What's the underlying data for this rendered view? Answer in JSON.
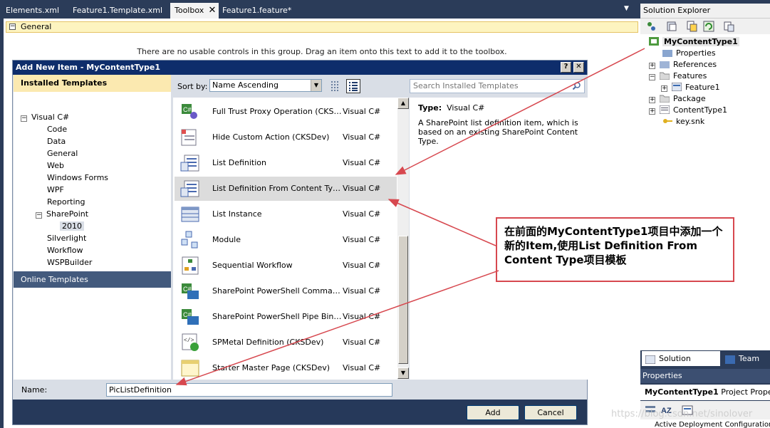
{
  "doc_tabs": [
    {
      "label": "Elements.xml",
      "active": false
    },
    {
      "label": "Feature1.Template.xml",
      "active": false
    },
    {
      "label": "Toolbox",
      "active": true
    },
    {
      "label": "Feature1.feature*",
      "active": false
    }
  ],
  "toolbox": {
    "group_label": "General",
    "empty_message": "There are no usable controls in this group. Drag an item onto this text to add it to the toolbox."
  },
  "dialog": {
    "title": "Add New Item - MyContentType1",
    "help_glyph": "?",
    "close_glyph": "✕",
    "installed_header": "Installed Templates",
    "tree": {
      "root": "Visual C#",
      "children": [
        "Code",
        "Data",
        "General",
        "Web",
        "Windows Forms",
        "WPF",
        "Reporting"
      ],
      "sharepoint": "SharePoint",
      "sharepoint_child": "2010",
      "after": [
        "Silverlight",
        "Workflow",
        "WSPBuilder"
      ]
    },
    "online_templates": "Online Templates",
    "sort_label": "Sort by:",
    "sort_value": "Name Ascending",
    "search_placeholder": "Search Installed Templates",
    "items": [
      {
        "name": "Full Trust Proxy Operation (CKSDev)",
        "lang": "Visual C#",
        "icon": "proxy-icon"
      },
      {
        "name": "Hide Custom Action (CKSDev)",
        "lang": "Visual C#",
        "icon": "custom-action-icon"
      },
      {
        "name": "List Definition",
        "lang": "Visual C#",
        "icon": "list-definition-icon"
      },
      {
        "name": "List Definition From Content Type",
        "lang": "Visual C#",
        "icon": "list-definition-icon"
      },
      {
        "name": "List Instance",
        "lang": "Visual C#",
        "icon": "list-instance-icon"
      },
      {
        "name": "Module",
        "lang": "Visual C#",
        "icon": "module-icon"
      },
      {
        "name": "Sequential Workflow",
        "lang": "Visual C#",
        "icon": "workflow-icon"
      },
      {
        "name": "SharePoint PowerShell CommandLet...",
        "lang": "Visual C#",
        "icon": "powershell-icon"
      },
      {
        "name": "SharePoint PowerShell Pipe Binding (...",
        "lang": "Visual C#",
        "icon": "powershell-icon"
      },
      {
        "name": "SPMetal Definition (CKSDev)",
        "lang": "Visual C#",
        "icon": "spmetal-icon"
      },
      {
        "name": "Starter Master Page (CKSDev)",
        "lang": "Visual C#",
        "icon": "master-page-icon"
      }
    ],
    "detail_type_label": "Type:",
    "detail_type_value": "Visual C#",
    "detail_description": "A SharePoint list definition item, which is based on an existing SharePoint Content Type.",
    "name_label": "Name:",
    "name_value": "PicListDefinition",
    "add_label": "Add",
    "cancel_label": "Cancel"
  },
  "solution_explorer": {
    "title": "Solution Explorer",
    "project": "MyContentType1",
    "nodes": [
      "Properties",
      "References",
      "Features",
      "Feature1",
      "Package",
      "ContentType1",
      "key.snk"
    ],
    "tab_solution": "Solution Explorer",
    "tab_team": "Team Exp"
  },
  "properties": {
    "title": "Properties",
    "selected_object": "MyContentType1",
    "selected_kind": "Project Propert",
    "first_row": "Active Deployment Configuration"
  },
  "callout": {
    "text": "在前面的MyContentType1项目中添加一个新的Item,使用List Definition From Content Type项目模板"
  },
  "watermark": "https://blog.csdn.net/sinolover",
  "colors": {
    "ide_background": "#2b3c59",
    "dialog_title": "#0e2d6b",
    "installed_header": "#fbe9b0",
    "callout_border": "#d7484f",
    "selected_item": "#dcdcdc"
  }
}
